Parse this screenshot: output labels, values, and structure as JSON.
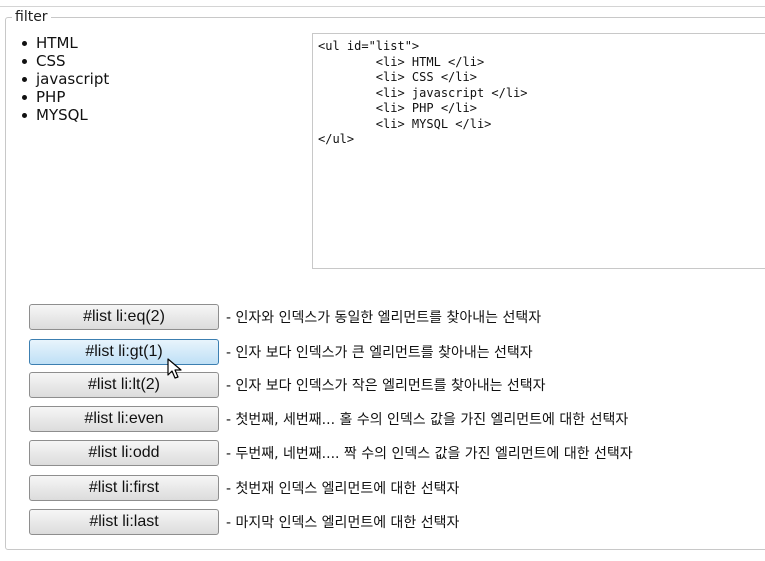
{
  "legend": "filter",
  "list_items": [
    "HTML",
    "CSS",
    "javascript",
    "PHP",
    "MYSQL"
  ],
  "code": "<ul id=\"list\">\n        <li> HTML </li>\n        <li> CSS </li>\n        <li> javascript </li>\n        <li> PHP </li>\n        <li> MYSQL </li>\n</ul>",
  "buttons": [
    {
      "label": "#list li:eq(2)",
      "desc": "- 인자와 인덱스가 동일한 엘리먼트를 찾아내는 선택자"
    },
    {
      "label": "#list li:gt(1)",
      "desc": "- 인자 보다 인덱스가 큰 엘리먼트를 찾아내는 선택자"
    },
    {
      "label": "#list li:lt(2)",
      "desc": "- 인자 보다 인덱스가 작은 엘리먼트를 찾아내는 선택자"
    },
    {
      "label": "#list li:even",
      "desc": "- 첫번째, 세번째... 홀 수의 인덱스 값을 가진 엘리먼트에 대한 선택자"
    },
    {
      "label": "#list li:odd",
      "desc": "- 두번째, 네번째.... 짝 수의 인덱스 값을 가진 엘리먼트에 대한 선택자"
    },
    {
      "label": "#list li:first",
      "desc": "- 첫번재 인덱스 엘리먼트에 대한 선택자"
    },
    {
      "label": "#list li:last",
      "desc": "- 마지막 인덱스 엘리먼트에 대한 선택자"
    }
  ],
  "hovered_button_index": 1,
  "cursor": "mouse-pointer-icon"
}
